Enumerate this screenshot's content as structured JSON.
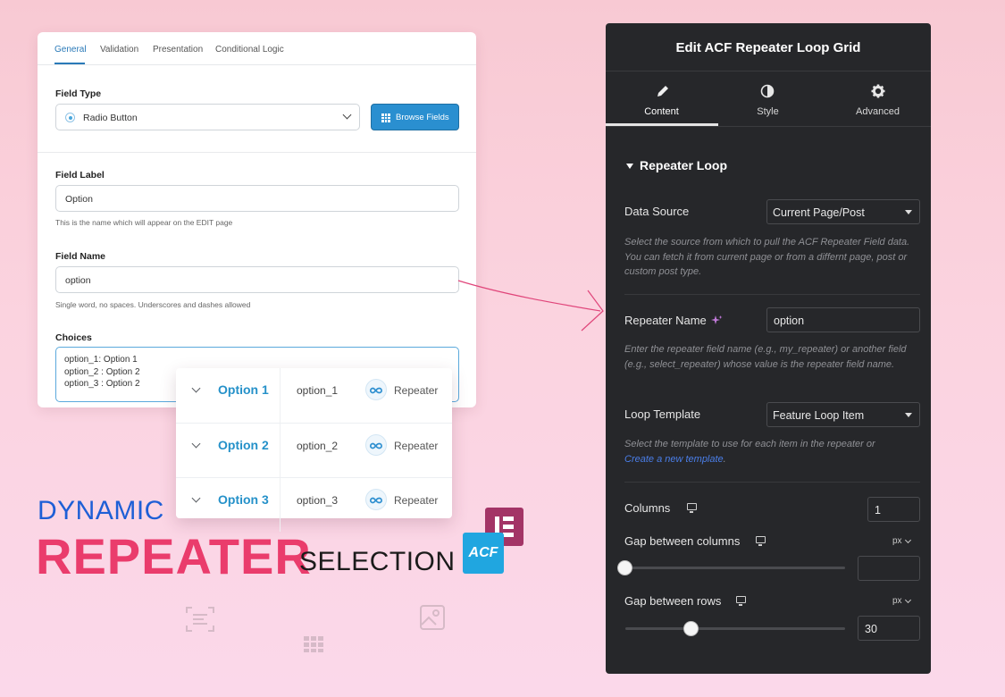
{
  "acf": {
    "tabs": [
      "General",
      "Validation",
      "Presentation",
      "Conditional Logic"
    ],
    "field_type": {
      "label": "Field Type",
      "value": "Radio Button",
      "browse_button": "Browse Fields"
    },
    "field_label": {
      "label": "Field Label",
      "value": "Option",
      "help": "This is the name which will appear on the EDIT page"
    },
    "field_name": {
      "label": "Field Name",
      "value": "option",
      "help": "Single word, no spaces. Underscores and dashes allowed"
    },
    "choices": {
      "label": "Choices",
      "lines": [
        "option_1: Option 1",
        "option_2 : Option 2",
        "option_3 : Option 2"
      ]
    }
  },
  "options": [
    {
      "label": "Option 1",
      "value": "option_1",
      "type": "Repeater"
    },
    {
      "label": "Option 2",
      "value": "option_2",
      "type": "Repeater"
    },
    {
      "label": "Option 3",
      "value": "option_3",
      "type": "Repeater"
    }
  ],
  "headline": {
    "dynamic": "DYNAMIC",
    "repeater": "REPEATER",
    "selection": "SELECTION",
    "acf_logo": "ACF"
  },
  "panel": {
    "title": "Edit ACF Repeater Loop Grid",
    "tabs": [
      "Content",
      "Style",
      "Advanced"
    ],
    "section": "Repeater Loop",
    "data_source": {
      "label": "Data Source",
      "value": "Current Page/Post",
      "help": "Select the source from which to pull the ACF Repeater Field data. You can fetch it from current page or from a differnt page, post or custom post type."
    },
    "repeater_name": {
      "label": "Repeater Name",
      "value": "option",
      "help": "Enter the repeater field name (e.g., my_repeater) or another field (e.g., select_repeater) whose value is the repeater field name."
    },
    "loop_template": {
      "label": "Loop Template",
      "value": "Feature Loop Item",
      "help": "Select the template to use for each item in the repeater or",
      "link": "Create a new template",
      "after_link": "."
    },
    "columns": {
      "label": "Columns",
      "value": "1"
    },
    "gap_columns": {
      "label": "Gap between columns",
      "unit": "px",
      "value": ""
    },
    "gap_rows": {
      "label": "Gap between rows",
      "unit": "px",
      "value": "30"
    }
  },
  "colors": {
    "accent_blue": "#2a8fd0",
    "headline_pink": "#ea3c6c",
    "headline_blue": "#1e5fd6",
    "panel_bg": "#26272a"
  }
}
